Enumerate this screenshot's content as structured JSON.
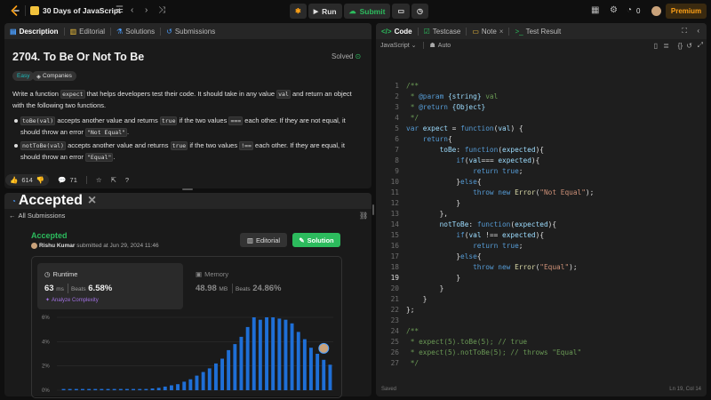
{
  "app": {
    "project_title": "30 Days of JavaScript",
    "run_label": "Run",
    "submit_label": "Submit",
    "streak_count": "0",
    "premium_label": "Premium"
  },
  "left_tabs": {
    "description": "Description",
    "editorial": "Editorial",
    "solutions": "Solutions",
    "submissions": "Submissions"
  },
  "problem": {
    "title": "2704. To Be Or Not To Be",
    "status": "Solved",
    "difficulty": "Easy",
    "companies": "Companies",
    "p1a": "Write a function",
    "p1_code1": "expect",
    "p1b": "that helps developers test their code. It should take in any value",
    "p1_code2": "val",
    "p1c": "and return an object with",
    "p1d": "the following two functions.",
    "b1_code": "toBe(val)",
    "b1a": "accepts another value and returns",
    "b1_true": "true",
    "b1b": "if the two values",
    "b1_op": "===",
    "b1c": "each other. If they are not equal, it",
    "b1d": "should throw an error",
    "b1_err": "\"Not Equal\"",
    "b1e": ".",
    "b2_code": "notToBe(val)",
    "b2a": "accepts another value and returns",
    "b2_true": "true",
    "b2b": "if the two values",
    "b2_op": "!==",
    "b2c": "each other. If they are equal, it should",
    "b2d": "throw an error",
    "b2_err": "\"Equal\"",
    "b2e": ".",
    "likes": "614",
    "comments": "71"
  },
  "submission": {
    "tab": "Accepted",
    "all_submissions": "All Submissions",
    "result": "Accepted",
    "author": "Rishu Kumar",
    "submitted_text": "submitted at Jun 29, 2024 11:46",
    "editorial_btn": "Editorial",
    "solution_btn": "Solution",
    "runtime_label": "Runtime",
    "runtime_value": "63",
    "runtime_unit": "ms",
    "runtime_beats_label": "Beats",
    "runtime_beats": "6.58%",
    "analyze": "Analyze Complexity",
    "memory_label": "Memory",
    "memory_value": "48.98",
    "memory_unit": "MB",
    "memory_beats_label": "Beats",
    "memory_beats": "24.86%"
  },
  "chart_data": {
    "type": "bar",
    "title": "",
    "xlabel": "",
    "ylabel": "",
    "yticks": [
      "6%",
      "4%",
      "2%",
      "0%"
    ],
    "ylim": [
      0,
      6
    ],
    "values": [
      0.1,
      0.1,
      0.1,
      0.1,
      0.1,
      0.1,
      0.1,
      0.1,
      0.1,
      0.1,
      0.1,
      0.1,
      0.1,
      0.1,
      0.15,
      0.2,
      0.3,
      0.4,
      0.5,
      0.7,
      0.9,
      1.2,
      1.5,
      1.8,
      2.2,
      2.6,
      3.3,
      3.8,
      4.4,
      5.2,
      6.0,
      5.8,
      6.0,
      6.0,
      5.9,
      5.8,
      5.5,
      4.8,
      4.2,
      3.5,
      3.0,
      2.5,
      2.1
    ],
    "highlight_index": 41,
    "bar_color": "#1f6fd6"
  },
  "editor": {
    "tabs": [
      "Code",
      "Testcase",
      "Note",
      "Test Result"
    ],
    "language": "JavaScript",
    "auto": "Auto",
    "current_line": 19,
    "status_left": "Saved",
    "status_right": "Ln 19, Col 14",
    "lines": [
      "/**",
      " * @param {string} val",
      " * @return {Object}",
      " */",
      "var expect = function(val) {",
      "    return{",
      "        toBe: function(expected){",
      "            if(val=== expected){",
      "                return true;",
      "            }else{",
      "                throw new Error(\"Not Equal\");",
      "            }",
      "        },",
      "        notToBe: function(expected){",
      "            if(val !== expected){",
      "                return true;",
      "            }else{",
      "                throw new Error(\"Equal\");",
      "            }",
      "        }",
      "    }",
      "};",
      "",
      "/**",
      " * expect(5).toBe(5); // true",
      " * expect(5).notToBe(5); // throws \"Equal\"",
      " */"
    ]
  }
}
